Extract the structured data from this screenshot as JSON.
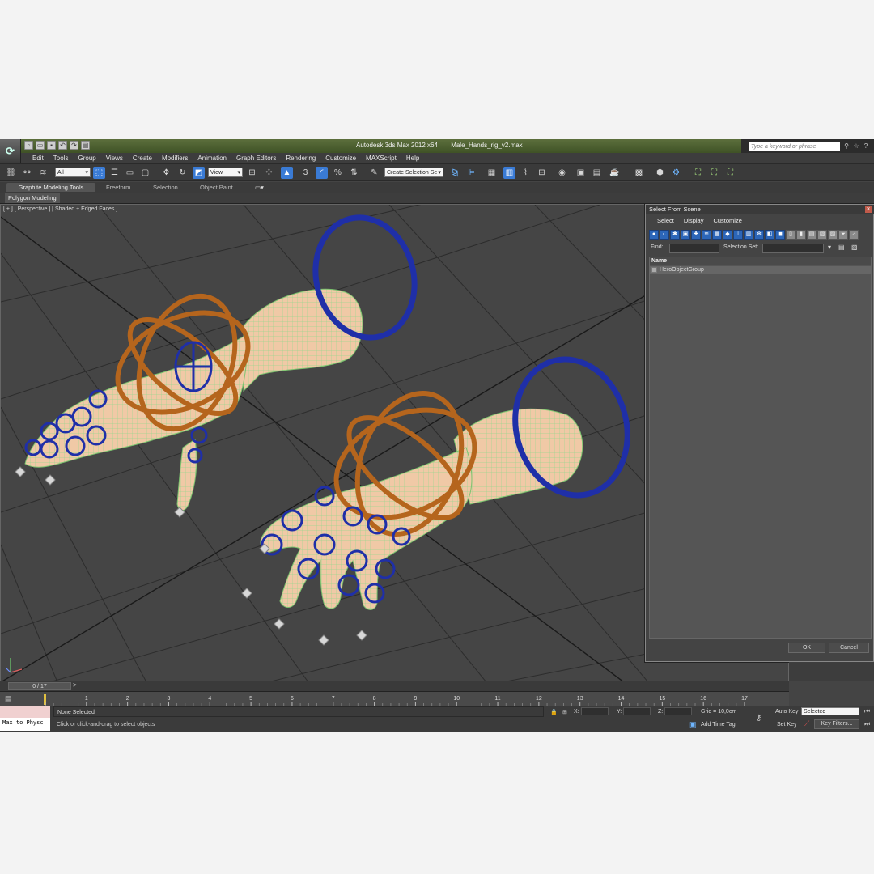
{
  "app": {
    "title": "Autodesk 3ds Max  2012 x64",
    "filename": "Male_Hands_rig_v2.max",
    "logo": "3ds-max-logo",
    "help_search_placeholder": "Type a keyword or phrase"
  },
  "menu": [
    "Edit",
    "Tools",
    "Group",
    "Views",
    "Create",
    "Modifiers",
    "Animation",
    "Graph Editors",
    "Rendering",
    "Customize",
    "MAXScript",
    "Help"
  ],
  "toolbar": {
    "filter_value": "All",
    "ref_coord_value": "View",
    "named_selection_value": "Create Selection Se",
    "snap_label": "3"
  },
  "ribbon": {
    "tabs": [
      "Graphite Modeling Tools",
      "Freeform",
      "Selection",
      "Object Paint"
    ],
    "active_tab": "Graphite Modeling Tools",
    "subtab": "Polygon Modeling"
  },
  "viewport": {
    "label": "[ + ] [ Perspective ] [ Shaded + Edged Faces ]"
  },
  "dialog": {
    "title": "Select From Scene",
    "menu": [
      "Select",
      "Display",
      "Customize"
    ],
    "find_label": "Find:",
    "selection_set_label": "Selection Set:",
    "column_header": "Name",
    "items": [
      "HeroObjectGroup"
    ],
    "ok_label": "OK",
    "cancel_label": "Cancel"
  },
  "timeslider": {
    "frame_display": "0 / 17",
    "current": 0,
    "total": 17,
    "ticks": [
      "1",
      "2",
      "3",
      "4",
      "5",
      "6",
      "7",
      "8",
      "9",
      "10",
      "11",
      "12",
      "13",
      "14",
      "15",
      "16",
      "17"
    ]
  },
  "status": {
    "maxscript_text": "Max to Physc",
    "selection_status": "None Selected",
    "prompt": "Click or click-and-drag to select objects",
    "x_label": "X:",
    "y_label": "Y:",
    "z_label": "Z:",
    "grid": "Grid = 10,0cm",
    "add_time_tag": "Add Time Tag",
    "auto_key": "Auto Key",
    "set_key": "Set Key",
    "selected_value": "Selected",
    "key_filters": "Key Filters..."
  },
  "colors": {
    "viewport_bg": "#454545",
    "skin": "#f0c9a6",
    "wire": "#8fd18a",
    "ring_orange": "#b5651d",
    "ring_blue": "#1f2fa8",
    "accent": "#3a7bd5"
  }
}
